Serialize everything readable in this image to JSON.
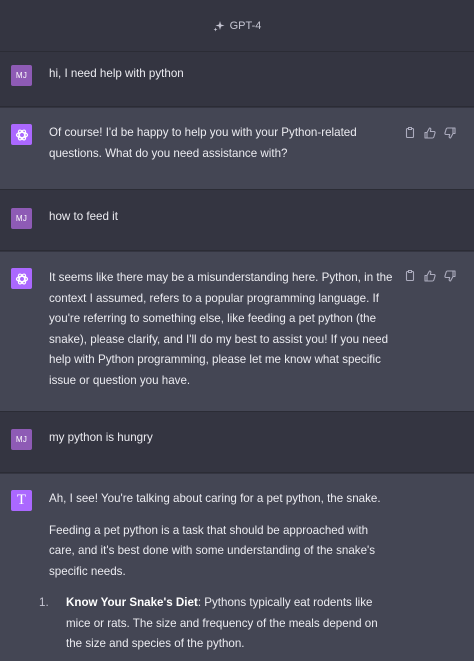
{
  "header": {
    "model_label": "GPT-4",
    "sparkle_icon": "sparkle-icon"
  },
  "user_initials": "MJ",
  "messages": [
    {
      "role": "user",
      "text": "hi, I need help with python"
    },
    {
      "role": "assistant",
      "text": "Of course! I'd be happy to help you with your Python-related questions. What do you need assistance with?"
    },
    {
      "role": "user",
      "text": "how to feed it"
    },
    {
      "role": "assistant",
      "text": "It seems like there may be a misunderstanding here. Python, in the context I assumed, refers to a popular programming language. If you're referring to something else, like feeding a pet python (the snake), please clarify, and I'll do my best to assist you! If you need help with Python programming, please let me know what specific issue or question you have."
    },
    {
      "role": "user",
      "text": "my python is hungry"
    },
    {
      "role": "assistant",
      "avatar_letter": "T",
      "paragraphs": [
        "Ah, I see! You're talking about caring for a pet python, the snake.",
        "Feeding a pet python is a task that should be approached with care, and it's best done with some understanding of the snake's specific needs."
      ],
      "list": [
        {
          "number": "1.",
          "title": "Know Your Snake's Diet",
          "text": ": Pythons typically eat rodents like mice or rats. The size and frequency of the meals depend on the size and species of the python."
        }
      ]
    }
  ],
  "actions": [
    "copy-icon",
    "thumbs-up-icon",
    "thumbs-down-icon"
  ]
}
